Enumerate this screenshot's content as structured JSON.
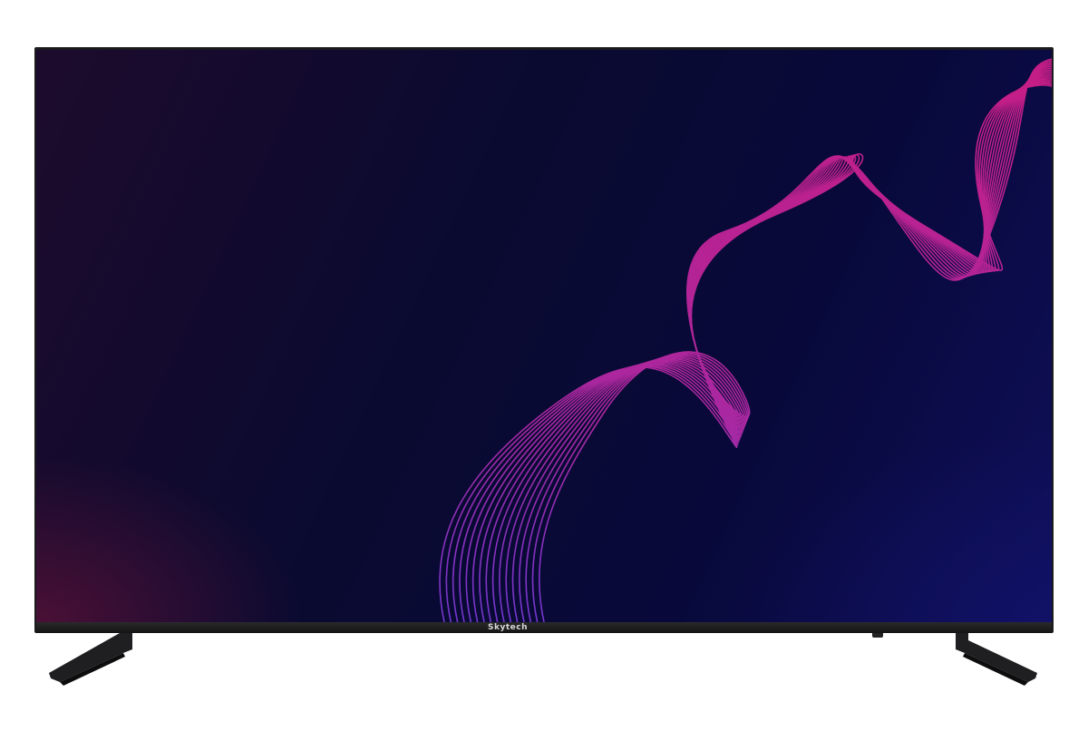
{
  "product": {
    "brand_label": "Skytech"
  },
  "colors": {
    "bezel": "#1b1b1d",
    "wave": "#c41d8f",
    "wave_lower": "#9a3fd6",
    "screen_dark": "#0a0a30"
  }
}
